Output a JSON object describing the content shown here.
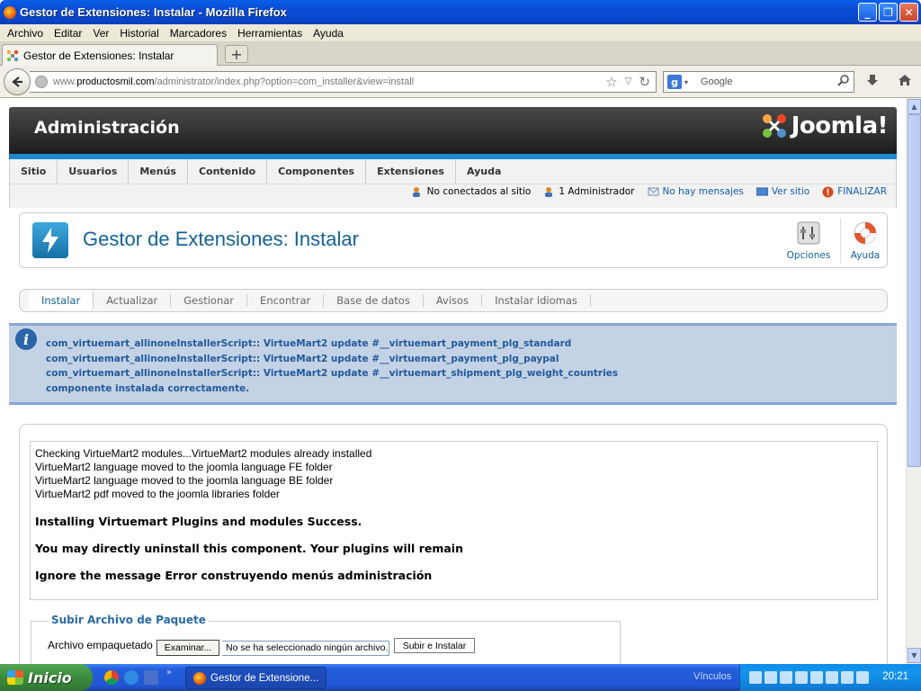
{
  "window": {
    "title": "Gestor de Extensiones: Instalar - Mozilla Firefox"
  },
  "menubar": {
    "items": [
      "Archivo",
      "Editar",
      "Ver",
      "Historial",
      "Marcadores",
      "Herramientas",
      "Ayuda"
    ]
  },
  "tab": {
    "label": "Gestor de Extensiones: Instalar"
  },
  "nav": {
    "url_prefix": "www.",
    "url_domain": "productosmil.com",
    "url_path": "/administrator/index.php?option=com_installer&view=install",
    "search_placeholder": "Google"
  },
  "admin": {
    "header_title": "Administración",
    "brand": "Joomla!",
    "top_menu": [
      "Sitio",
      "Usuarios",
      "Menús",
      "Contenido",
      "Componentes",
      "Extensiones",
      "Ayuda"
    ],
    "status": {
      "offline": "No conectados al sitio",
      "admins": "1 Administrador",
      "messages": "No hay mensajes",
      "view_site": "Ver sitio",
      "logout": "FINALIZAR"
    },
    "page_title": "Gestor de Extensiones: Instalar",
    "toolbar": {
      "options": "Opciones",
      "help": "Ayuda"
    },
    "subnav": [
      "Instalar",
      "Actualizar",
      "Gestionar",
      "Encontrar",
      "Base de datos",
      "Avisos",
      "Instalar idiomas"
    ],
    "message_lines": [
      "com_virtuemart_allinoneInstallerScript:: VirtueMart2 update #__virtuemart_payment_plg_standard",
      "com_virtuemart_allinoneInstallerScript:: VirtueMart2 update #__virtuemart_payment_plg_paypal",
      "com_virtuemart_allinoneInstallerScript:: VirtueMart2 update #__virtuemart_shipment_plg_weight_countries",
      "componente instalada correctamente."
    ],
    "log_lines": [
      "Checking VirtueMart2 modules...VirtueMart2 modules already installed",
      "VirtueMart2 language moved to the joomla language FE folder",
      "VirtueMart2 language moved to the joomla language BE folder",
      "VirtueMart2 pdf moved to the joomla libraries folder"
    ],
    "log_headings": [
      "Installing Virtuemart Plugins and modules Success.",
      "You may directly uninstall this component. Your plugins will remain",
      "Ignore the message Error construyendo menús administración"
    ],
    "upload": {
      "legend": "Subir Archivo de Paquete",
      "label": "Archivo empaquetado",
      "browse": "Examinar...",
      "no_file": "No se ha seleccionado ningún archivo.",
      "submit": "Subir e Instalar"
    }
  },
  "taskbar": {
    "start": "Inicio",
    "task_label": "Gestor de Extensione...",
    "links": "Vínculos",
    "clock": "20:21"
  }
}
